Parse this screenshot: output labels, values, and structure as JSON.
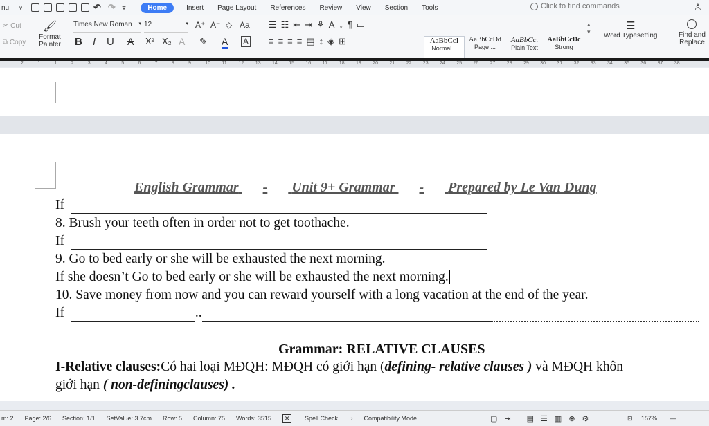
{
  "menu": {
    "left_label": "nu",
    "tabs": [
      "Home",
      "Insert",
      "Page Layout",
      "References",
      "Review",
      "View",
      "Section",
      "Tools"
    ],
    "search_placeholder": "Click to find commands"
  },
  "toolbar": {
    "cut": "Cut",
    "copy": "Copy",
    "format_painter_line1": "Format",
    "format_painter_line2": "Painter",
    "font_name": "Times New Roman",
    "font_size": "12",
    "styles": [
      {
        "sample": "AaBbCcI",
        "label": "Normal..."
      },
      {
        "sample": "AaBbCcDd",
        "label": "Page ..."
      },
      {
        "sample": "AaBbCc.",
        "label": "Plain Text"
      },
      {
        "sample": "AaBbCcDc",
        "label": "Strong"
      }
    ],
    "word_typesetting": "Word Typesetting",
    "find_line1": "Find and",
    "find_line2": "Replace"
  },
  "ruler": {
    "ticks": [
      "2",
      "1",
      "1",
      "2",
      "3",
      "4",
      "5",
      "6",
      "7",
      "8",
      "9",
      "10",
      "11",
      "12",
      "13",
      "14",
      "15",
      "16",
      "17",
      "18",
      "19",
      "20",
      "21",
      "22",
      "23",
      "24",
      "25",
      "26",
      "27",
      "28",
      "29",
      "30",
      "31",
      "32",
      "33",
      "34",
      "35",
      "36",
      "37",
      "38"
    ]
  },
  "document": {
    "header": {
      "part1": "English Grammar",
      "sep": "-",
      "part2": "Unit 9+ Grammar",
      "part3": "Prepared by Le Van Dung"
    },
    "if_label": "If",
    "line8": "8. Brush your teeth often in order not to get toothache.",
    "line9": "9. Go to bed early or she will be exhausted the next morning.",
    "answer9": "If she doesn’t  Go to bed early or she will be exhausted the next morning.",
    "line10": "10. Save money from now and you can reward yourself with a long vacation at the end of the year.",
    "grammar_title": "Grammar:  RELATIVE CLAUSES",
    "rel_bold": "I-Relative clauses:",
    "rel_text": "Có hai loại MĐQH: MĐQH có giới hạn (",
    "rel_def": "defining- relative clauses )",
    "rel_text2": " và MĐQH khôn",
    "rel_line2a": "giới hạn ",
    "rel_line2b": "( non-definingclauses) ."
  },
  "status": {
    "items": [
      "m: 2",
      "Page: 2/6",
      "Section: 1/1",
      "SetValue: 3.7cm",
      "Row: 5",
      "Column: 75",
      "Words: 3515",
      "Spell Check",
      "Compatibility Mode"
    ],
    "zoom": "157%"
  }
}
